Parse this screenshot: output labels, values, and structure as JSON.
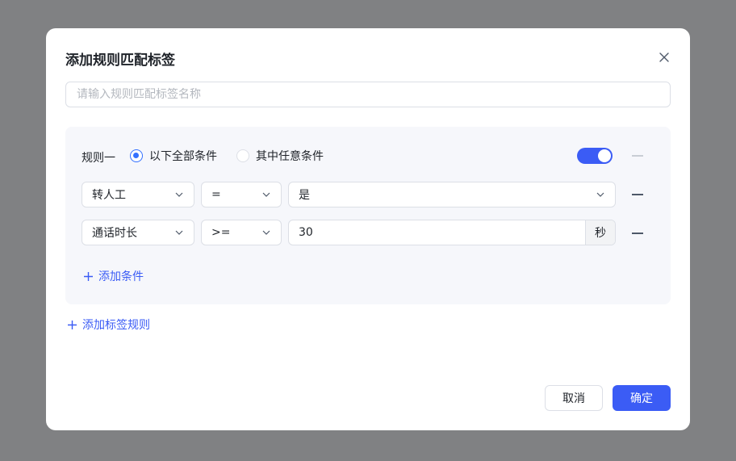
{
  "dialog": {
    "title": "添加规则匹配标签",
    "name_placeholder": "请输入规则匹配标签名称",
    "name_value": ""
  },
  "rule": {
    "label": "规则一",
    "match_options": [
      {
        "label": "以下全部条件",
        "selected": true
      },
      {
        "label": "其中任意条件",
        "selected": false
      }
    ],
    "enabled": true,
    "conditions": [
      {
        "field": "转人工",
        "operator": "=",
        "value": "是"
      },
      {
        "field": "通话时长",
        "operator": ">=",
        "value": "30",
        "unit": "秒"
      }
    ],
    "add_condition_label": "添加条件"
  },
  "add_rule_label": "添加标签规则",
  "footer": {
    "cancel_label": "取消",
    "confirm_label": "确定"
  },
  "colors": {
    "accent": "#3b5cf5",
    "overlay": "#808183",
    "panel": "#f6f7fb"
  },
  "icons": [
    "close-icon",
    "chevron-down-icon",
    "minus-icon",
    "plus-icon"
  ]
}
